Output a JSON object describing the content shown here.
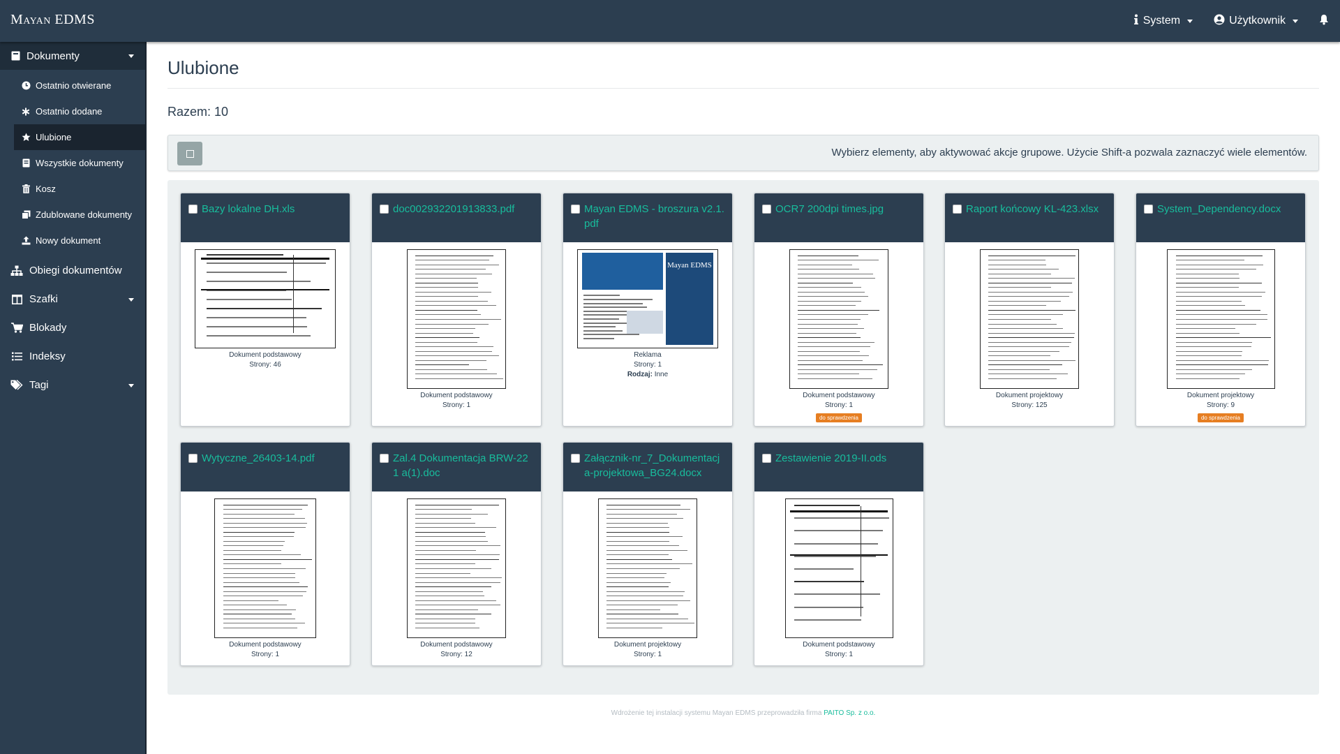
{
  "brand": "Mayan EDMS",
  "nav": {
    "system": "System",
    "user": "Użytkownik"
  },
  "sidebar": {
    "documents": "Dokumenty",
    "sub": [
      {
        "label": "Ostatnio otwierane",
        "icon": "clock-icon"
      },
      {
        "label": "Ostatnio dodane",
        "icon": "asterisk-icon"
      },
      {
        "label": "Ulubione",
        "icon": "star-icon",
        "active": true
      },
      {
        "label": "Wszystkie dokumenty",
        "icon": "file-icon"
      },
      {
        "label": "Kosz",
        "icon": "trash-icon"
      },
      {
        "label": "Zdublowane dokumenty",
        "icon": "copy-icon"
      },
      {
        "label": "Nowy dokument",
        "icon": "upload-icon"
      }
    ],
    "workflows": "Obiegi dokumentów",
    "cabinets": "Szafki",
    "checkouts": "Blokady",
    "indexes": "Indeksy",
    "tags": "Tagi"
  },
  "page": {
    "title": "Ulubione",
    "total": "Razem: 10",
    "bulk_message": "Wybierz elementy, aby aktywować akcje grupowe. Użycie Shift-a pozwala zaznaczyć wiele elementów."
  },
  "documents": [
    {
      "title": "Bazy lokalne DH.xls",
      "type": "Dokument podstawowy",
      "pages": "Strony: 46"
    },
    {
      "title": "doc002932201913833.pdf",
      "type": "Dokument podstawowy",
      "pages": "Strony: 1"
    },
    {
      "title": "Mayan EDMS - broszura v2.1.pdf",
      "type": "Reklama",
      "pages": "Strony: 1",
      "kind_label": "Rodzaj:",
      "kind_value": "Inne",
      "cover_text": "Mayan EDMS"
    },
    {
      "title": "OCR7 200dpi times.jpg",
      "type": "Dokument podstawowy",
      "pages": "Strony: 1",
      "badge": "do sprawdzenia"
    },
    {
      "title": "Raport końcowy KL-423.xlsx",
      "type": "Dokument projektowy",
      "pages": "Strony: 125"
    },
    {
      "title": "System_Dependency.docx",
      "type": "Dokument projektowy",
      "pages": "Strony: 9",
      "badge": "do sprawdzenia"
    },
    {
      "title": "Wytyczne_26403-14.pdf",
      "type": "Dokument podstawowy",
      "pages": "Strony: 1"
    },
    {
      "title": "Zal.4 Dokumentacja BRW-221 a(1).doc",
      "type": "Dokument podstawowy",
      "pages": "Strony: 12"
    },
    {
      "title": "Załącznik-nr_7_Dokumentacja-projektowa_BG24.docx",
      "type": "Dokument projektowy",
      "pages": "Strony: 1"
    },
    {
      "title": "Zestawienie 2019-II.ods",
      "type": "Dokument podstawowy",
      "pages": "Strony: 1"
    }
  ],
  "footer": {
    "text": "Wdrożenie tej instalacji systemu Mayan EDMS przeprowadziła firma ",
    "company": "PAITO Sp. z o.o."
  },
  "colors": {
    "navbar": "#2c3e50",
    "accent": "#18bc9c",
    "badge": "#e67e22",
    "panel": "#ecf0f1"
  }
}
